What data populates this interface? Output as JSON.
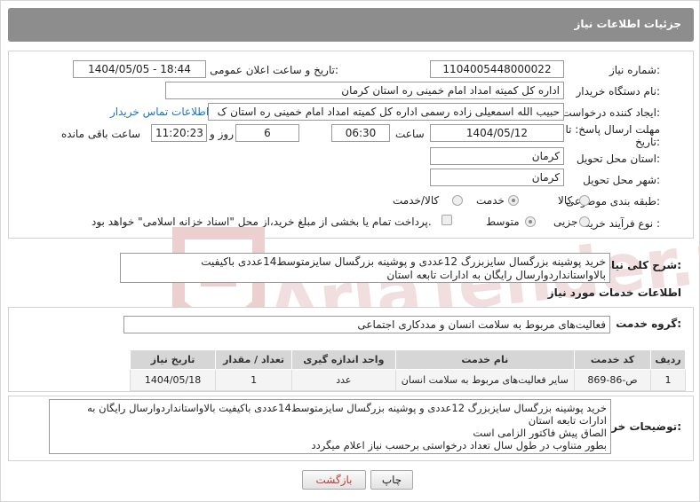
{
  "header": {
    "title": "جزئیات اطلاعات نیاز"
  },
  "form": {
    "need_number_label": "شماره نیاز:",
    "need_number": "1104005448000022",
    "announce_label": "تاریخ و ساعت اعلان عمومی:",
    "announce_value": "1404/05/05 - 18:44",
    "buyer_org_label": "نام دستگاه خریدار:",
    "buyer_org": "اداره کل کمیته امداد امام خمینی  ره  استان کرمان",
    "creator_label": "ایجاد کننده درخواست:",
    "creator": "حبیب الله اسمعیلی زاده رسمی  اداره کل کمیته امداد امام خمینی  ره  استان ک",
    "contact_link": "اطلاعات تماس خریدار",
    "deadline_label_1": "مهلت ارسال پاسخ: تا",
    "deadline_label_2": "تاریخ:",
    "deadline_date": "1404/05/12",
    "time_label": "ساعت",
    "deadline_time": "06:30",
    "days_value": "6",
    "days_label": "روز و",
    "remaining_time": "11:20:23",
    "remaining_label": "ساعت باقی مانده",
    "province_label": "استان محل تحویل:",
    "province": "کرمان",
    "city_label": "شهر محل تحویل:",
    "city": "کرمان",
    "category_label": "طبقه بندی موضوعی:",
    "category_options": [
      "کالا",
      "خدمت",
      "کالا/خدمت"
    ],
    "process_label": "نوع فرآیند خرید :",
    "process_options": [
      "جزیی",
      "متوسط"
    ],
    "payment_note": "پرداخت تمام یا بخشی از مبلغ خرید،از محل \"اسناد خزانه اسلامی\" خواهد بود."
  },
  "summary": {
    "label": "شرح کلی نیاز:",
    "text": "خرید پوشینه بزرگسال سایزبزرگ 12عددی و پوشینه بزرگسال سایزمتوسط14عددی باکیفیت بالاواستانداردوارسال رایگان به ادارات تابعه استان"
  },
  "services": {
    "title": "اطلاعات خدمات مورد نیاز",
    "group_label": "گروه خدمت:",
    "group_value": "فعالیت‌های مربوط به سلامت انسان و مددکاری اجتماعی",
    "columns": [
      "ردیف",
      "کد خدمت",
      "نام خدمت",
      "واحد اندازه گیری",
      "تعداد / مقدار",
      "تاریخ نیاز"
    ],
    "rows": [
      [
        "1",
        "ص-86-869",
        "سایر فعالیت‌های مربوط به سلامت انسان",
        "عدد",
        "1",
        "1404/05/18"
      ]
    ]
  },
  "buyer_notes": {
    "label": "توضیحات خریدار:",
    "lines": [
      "خرید پوشینه بزرگسال سایزبزرگ 12عددی و پوشینه بزرگسال سایزمتوسط14عددی باکیفیت بالاواستانداردوارسال رایگان به",
      "ادارات تابعه استان",
      "الصاق پیش فاکتور الزامی است",
      "بطور متناوب در طول سال تعداد درخواستی برحسب نیاز اعلام میگردد"
    ]
  },
  "actions": {
    "print_label": "چاپ",
    "back_label": "بازگشت"
  },
  "watermark": {
    "text": "AriaTender.neT"
  },
  "colors": {
    "title_bar": "#8d8d8d",
    "link": "#1a73c7",
    "back_text": "#c23b3b",
    "watermark": "#e9c9c9"
  }
}
